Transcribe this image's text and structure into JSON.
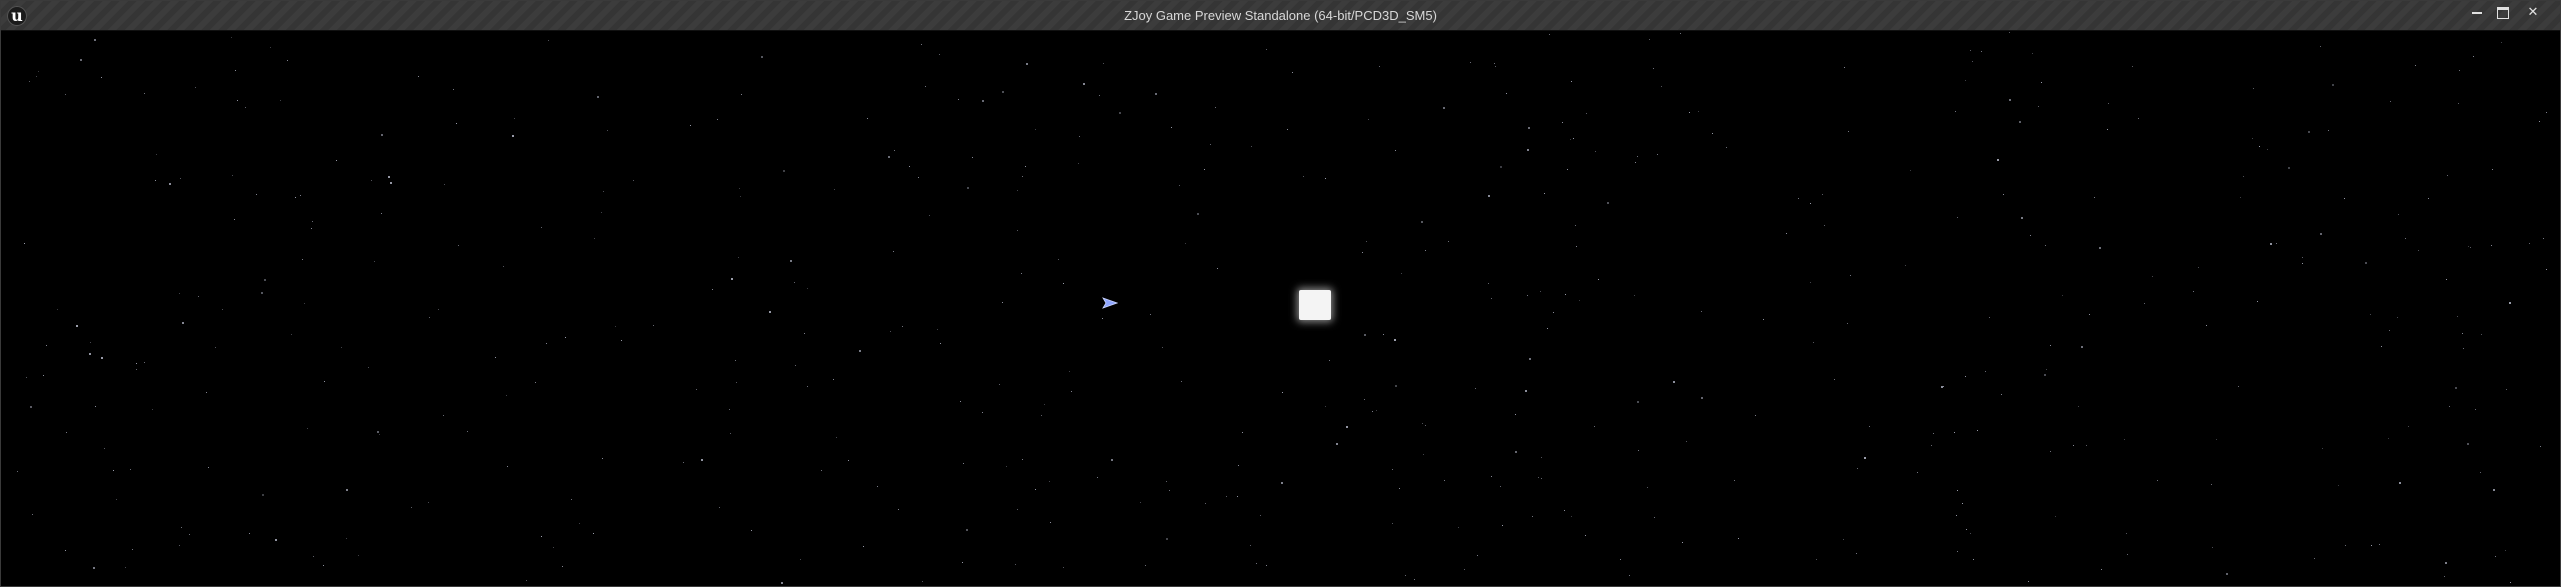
{
  "window": {
    "title": "ZJoy Game Preview Standalone (64-bit/PCD3D_SM5)",
    "logo_icon": "unreal-engine-logo-icon",
    "controls": {
      "minimize_icon": "minimize-icon",
      "maximize_icon": "maximize-icon",
      "close_icon": "close-icon",
      "close_glyph": "✕"
    }
  },
  "scene": {
    "background_color": "#000000",
    "star_color": "#cfd3e6",
    "player_ship_color": "#8fa6ff",
    "crate_color": "#f4f4f4"
  }
}
